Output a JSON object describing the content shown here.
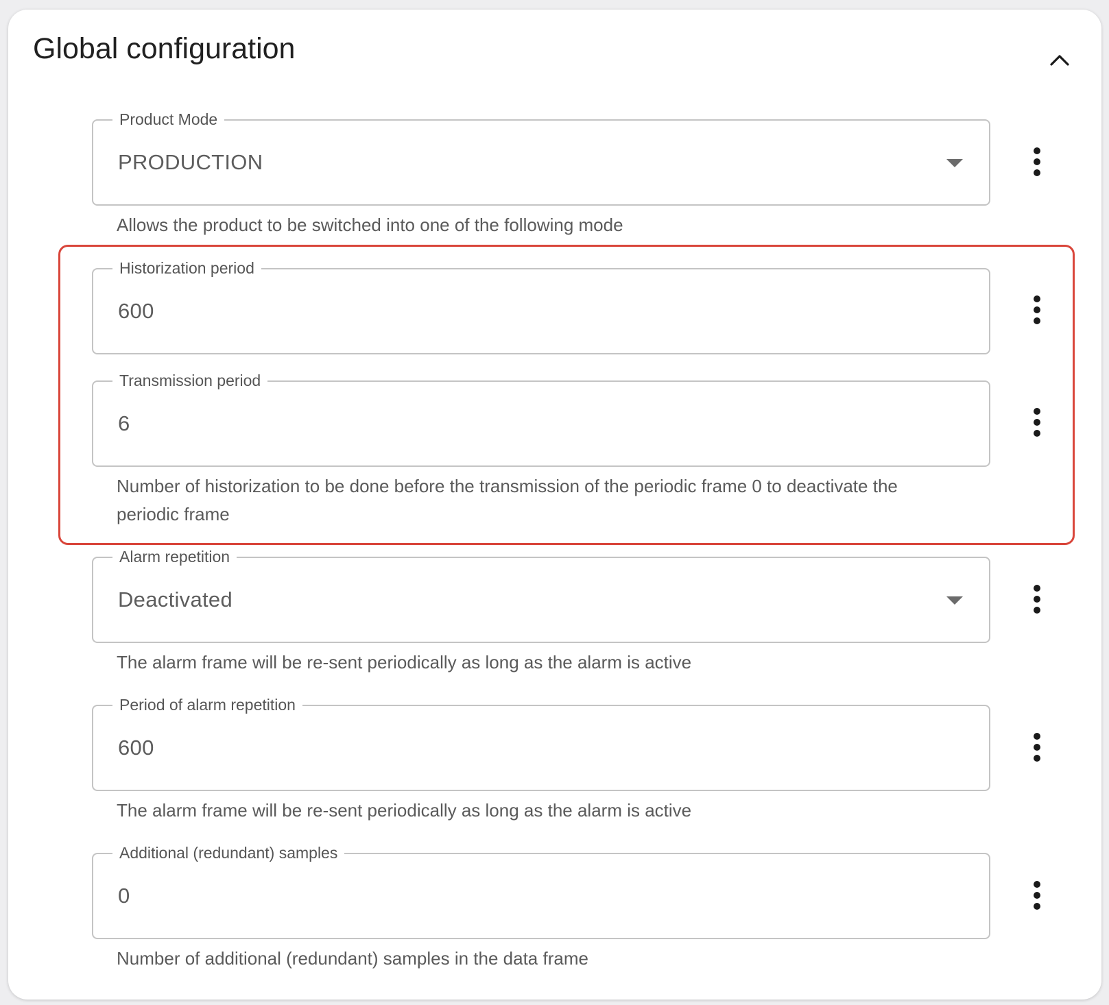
{
  "panel": {
    "title": "Global configuration",
    "collapse_icon": "chevron-up-icon"
  },
  "fields": {
    "product_mode": {
      "label": "Product Mode",
      "value": "PRODUCTION",
      "type": "select",
      "helper": "Allows the product to be switched into one of the following mode"
    },
    "historization_period": {
      "label": "Historization period",
      "value": "600",
      "type": "input"
    },
    "transmission_period": {
      "label": "Transmission period",
      "value": "6",
      "type": "input",
      "helper": "Number of historization to be done before the transmission of the periodic frame 0 to deactivate the periodic frame"
    },
    "alarm_repetition": {
      "label": "Alarm repetition",
      "value": "Deactivated",
      "type": "select",
      "helper": "The alarm frame will be re-sent periodically as long as the alarm is active"
    },
    "period_of_alarm_repetition": {
      "label": "Period of alarm repetition",
      "value": "600",
      "type": "input",
      "helper": "The alarm frame will be re-sent periodically as long as the alarm is active"
    },
    "additional_samples": {
      "label": "Additional (redundant) samples",
      "value": "0",
      "type": "input",
      "helper": "Number of additional (redundant) samples in the data frame"
    }
  },
  "icons": {
    "field_menu": "more-vertical-icon",
    "select_arrow": "dropdown-arrow-icon"
  },
  "colors": {
    "highlight_border": "#d9463b",
    "field_border": "#c4c4c4",
    "text_primary": "#202020",
    "text_secondary": "#5a5a5a"
  }
}
